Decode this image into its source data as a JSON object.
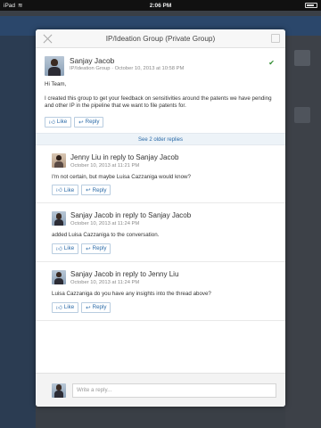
{
  "status_bar": {
    "device": "iPad",
    "time": "2:06 PM"
  },
  "dialog": {
    "title": "IP/Ideation Group (Private Group)"
  },
  "original_post": {
    "author": "Sanjay Jacob",
    "group": "IP/Ideation Group",
    "timestamp": "October 10, 2013 at 10:58 PM",
    "status_icon": "check-icon",
    "greeting": "Hi Team,",
    "body": "I created this group to get your feedback on sensitivities around the patents we have pending and other IP in the pipeline that we want to file patents for.",
    "like_label": "Like",
    "reply_label": "Reply"
  },
  "older_replies_label": "See 2 older replies",
  "replies": [
    {
      "heading": "Jenny Liu in reply to Sanjay Jacob",
      "timestamp": "October 10, 2013 at 11:21 PM",
      "body": "I'm not certain, but maybe Luisa Cazzaniga would know?",
      "like_label": "Like",
      "reply_label": "Reply"
    },
    {
      "heading": "Sanjay Jacob in reply to Sanjay Jacob",
      "timestamp": "October 10, 2013 at 11:24 PM",
      "body": "added Luisa Cazzaniga to the conversation.",
      "like_label": "Like",
      "reply_label": "Reply"
    },
    {
      "heading": "Sanjay Jacob in reply to Jenny Liu",
      "timestamp": "October 10, 2013 at 11:24 PM",
      "body": "Luisa Cazzaniga do you have any insights into the thread above?",
      "like_label": "Like",
      "reply_label": "Reply"
    }
  ],
  "composer": {
    "placeholder": "Write a reply..."
  },
  "colors": {
    "accent": "#2a6aa8",
    "check": "#2e8b2e"
  }
}
